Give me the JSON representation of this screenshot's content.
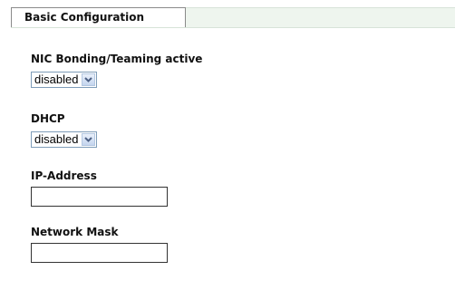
{
  "tabs": [
    {
      "label": "Basic Configuration",
      "active": true
    }
  ],
  "form": {
    "nic_bonding": {
      "label": "NIC Bonding/Teaming active",
      "selected": "disabled"
    },
    "dhcp": {
      "label": "DHCP",
      "selected": "disabled"
    },
    "ip_address": {
      "label": "IP-Address",
      "value": ""
    },
    "network_mask": {
      "label": "Network Mask",
      "value": ""
    }
  },
  "colors": {
    "tab_bar_background": "#eef5ee",
    "select_border": "#7f9db9",
    "dropdown_arrow": "#4d6185"
  }
}
